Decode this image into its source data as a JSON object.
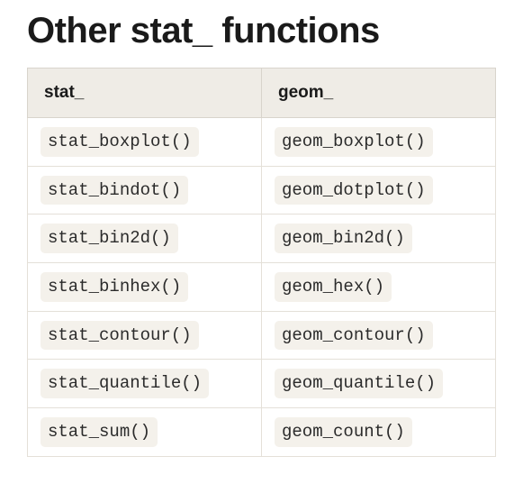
{
  "title": "Other stat_ functions",
  "headers": {
    "stat": "stat_",
    "geom": "geom_"
  },
  "rows": [
    {
      "stat": "stat_boxplot()",
      "geom": "geom_boxplot()"
    },
    {
      "stat": "stat_bindot()",
      "geom": "geom_dotplot()"
    },
    {
      "stat": "stat_bin2d()",
      "geom": "geom_bin2d()"
    },
    {
      "stat": "stat_binhex()",
      "geom": "geom_hex()"
    },
    {
      "stat": "stat_contour()",
      "geom": "geom_contour()"
    },
    {
      "stat": "stat_quantile()",
      "geom": "geom_quantile()"
    },
    {
      "stat": "stat_sum()",
      "geom": "geom_count()"
    }
  ]
}
